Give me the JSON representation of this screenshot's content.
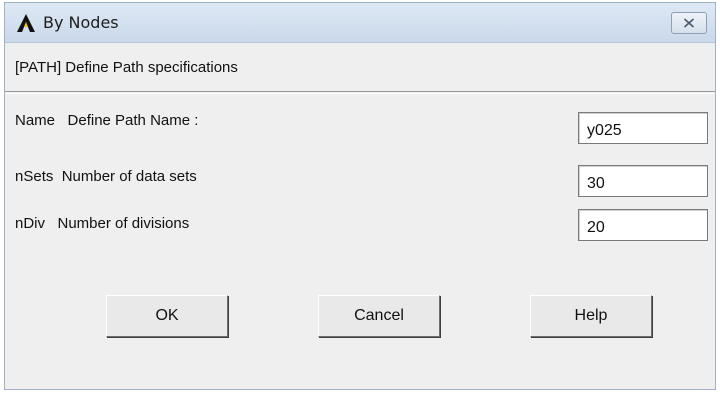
{
  "window": {
    "title": "By Nodes"
  },
  "header": {
    "text": "[PATH] Define Path specifications"
  },
  "fields": [
    {
      "label": "Name   Define Path Name :",
      "value": "y025"
    },
    {
      "label": "nSets  Number of data sets",
      "value": "30"
    },
    {
      "label": "nDiv   Number of divisions",
      "value": "20"
    }
  ],
  "buttons": {
    "ok": "OK",
    "cancel": "Cancel",
    "help": "Help"
  },
  "icons": {
    "app": "ansys-logo-icon",
    "close": "close-icon"
  },
  "colors": {
    "titlebar": "#c9d8ea",
    "dialog_bg": "#efefef",
    "logo": "#111111"
  }
}
